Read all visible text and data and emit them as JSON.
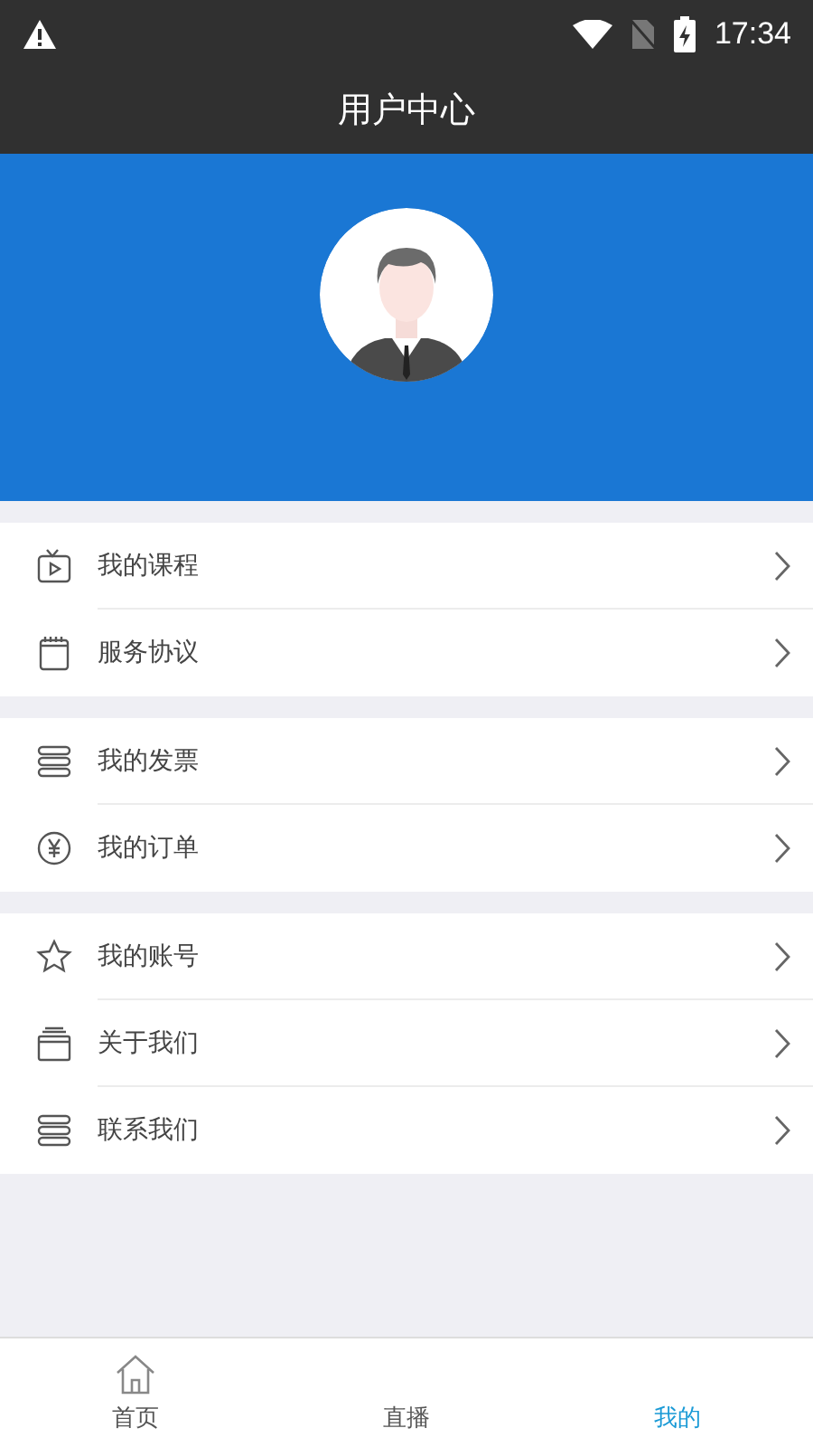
{
  "status_bar": {
    "time": "17:34"
  },
  "title_bar": {
    "title": "用户中心"
  },
  "menu_groups": [
    {
      "items": [
        {
          "label": "我的课程",
          "kind": "tv"
        },
        {
          "label": "服务协议",
          "kind": "calendar"
        }
      ]
    },
    {
      "items": [
        {
          "label": "我的发票",
          "kind": "stack"
        },
        {
          "label": "我的订单",
          "kind": "yen"
        }
      ]
    },
    {
      "items": [
        {
          "label": "我的账号",
          "kind": "star"
        },
        {
          "label": "关于我们",
          "kind": "card"
        },
        {
          "label": "联系我们",
          "kind": "stack"
        }
      ]
    }
  ],
  "tab_bar": [
    {
      "label": "首页",
      "kind": "home",
      "selected": false
    },
    {
      "label": "直播",
      "selected": false
    },
    {
      "label": "我的",
      "selected": true
    }
  ]
}
